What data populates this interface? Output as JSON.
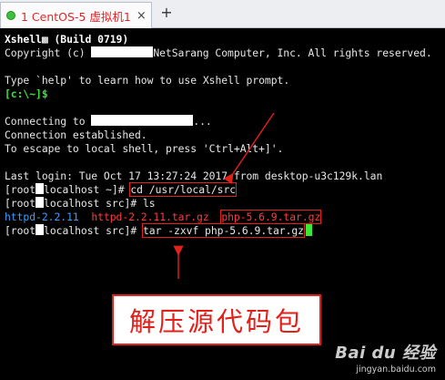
{
  "tab": {
    "label": "1 CentOS-5 虚拟机1",
    "close": "×",
    "add": "+",
    "status_color": "#3cc13c"
  },
  "terminal": {
    "banner_title": "Xshell",
    "banner_build": " (Build 0719)",
    "copyright_prefix": "Copyright (c) ",
    "copyright_suffix": "NetSarang Computer, Inc. All rights reserved.",
    "help_line": "Type `help' to learn how to use Xshell prompt.",
    "local_prompt": "[c:\\~]$",
    "connecting": "Connecting to ",
    "connecting_suffix": "...",
    "established": "Connection established.",
    "escape": "To escape to local shell, press 'Ctrl+Alt+]'.",
    "last_login": "Last login: Tue Oct 17 13:27:24 2017 from desktop-u3c129k.lan",
    "p1_a": "[root",
    "p1_b": "localhost ~]# ",
    "cmd1": "cd /usr/local/src",
    "p2_a": "[root",
    "p2_b": "localhost src]# ",
    "cmd2": "ls",
    "ls_items": [
      "httpd-2.2.11",
      "httpd-2.2.11.tar.gz",
      "php-5.6.9.tar.gz"
    ],
    "p3_a": "[root",
    "p3_b": "localhost src]# ",
    "cmd3": "tar -zxvf php-5.6.9.tar.gz"
  },
  "annotation": {
    "text": "解压源代码包",
    "color": "#e3211b"
  },
  "watermark": {
    "logo": "Bai du 经验",
    "url": "jingyan.baidu.com"
  }
}
